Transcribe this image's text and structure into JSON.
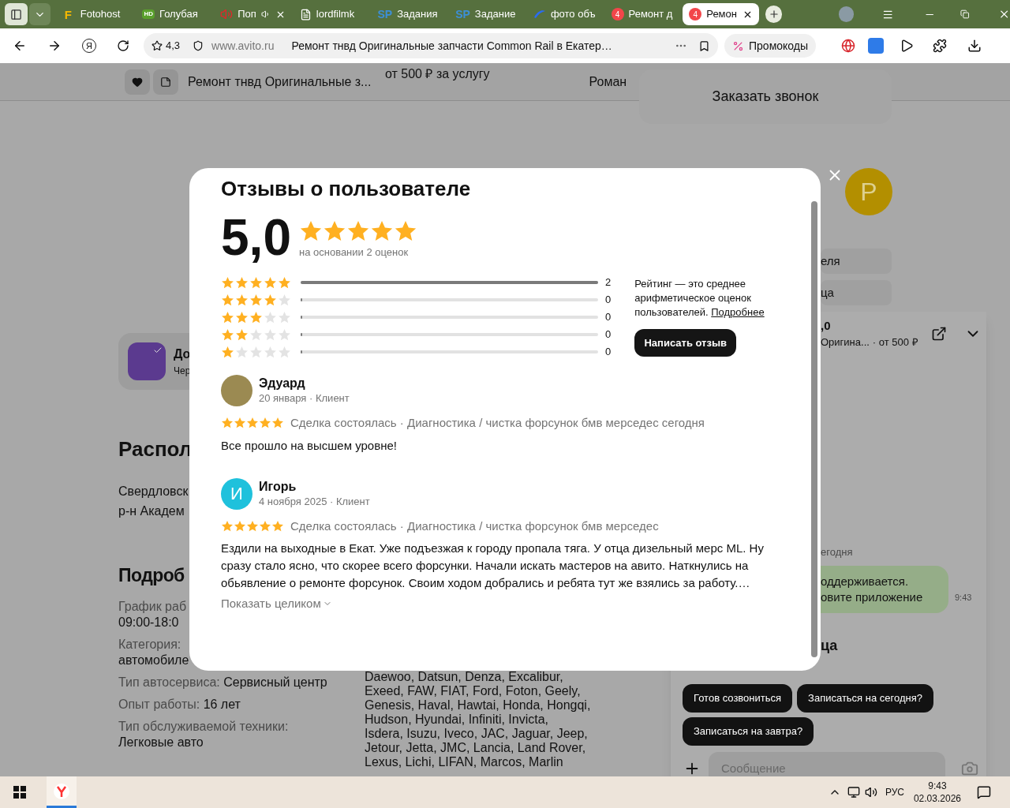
{
  "browser": {
    "tabs": [
      {
        "title": "Fotohost",
        "icon": {
          "kind": "letter",
          "text": "F"
        },
        "audio": false,
        "closable": false,
        "selected": false
      },
      {
        "title": "Голубая",
        "icon": {
          "kind": "hd",
          "text": "HD"
        },
        "audio": false,
        "closable": false,
        "selected": false
      },
      {
        "title": "Поп",
        "icon": {
          "kind": "sound"
        },
        "audio": true,
        "closable": true,
        "selected": false
      },
      {
        "title": "lordfilmk",
        "icon": {
          "kind": "page"
        },
        "audio": false,
        "closable": false,
        "selected": false
      },
      {
        "title": "Задания",
        "icon": {
          "kind": "sp",
          "text": "SP"
        },
        "audio": false,
        "closable": false,
        "selected": false
      },
      {
        "title": "Задание",
        "icon": {
          "kind": "sp",
          "text": "SP"
        },
        "audio": false,
        "closable": false,
        "selected": false
      },
      {
        "title": "фото объ",
        "icon": {
          "kind": "swoosh"
        },
        "audio": false,
        "closable": false,
        "selected": false
      },
      {
        "title": "Ремонт д",
        "icon": {
          "kind": "count",
          "text": "4"
        },
        "audio": false,
        "closable": false,
        "selected": false
      },
      {
        "title": "Ремон",
        "icon": {
          "kind": "count",
          "text": "4"
        },
        "audio": false,
        "closable": true,
        "selected": true
      }
    ],
    "address_bar": {
      "yandex_button": "Я",
      "rating": "4,3",
      "domain": "www.avito.ru",
      "page_title": "Ремонт тнвд Оригинальные запчасти Common Rail в Екатер…",
      "promo": "Промокоды"
    }
  },
  "page": {
    "header": {
      "title": "Ремонт тнвд Оригинальные з...",
      "price": "от 500 ₽ за услугу",
      "seller": "Роман",
      "call_button": "Заказать звонок"
    },
    "promo_card": {
      "title": "До",
      "subtitle": "Чер"
    },
    "location": {
      "heading": "Распол",
      "lines": [
        "Свердловск",
        "р-н Академ"
      ]
    },
    "details": {
      "heading": "Подроб",
      "items": [
        {
          "kind": "stacked",
          "label": "График раб",
          "value": "09:00-18:0"
        },
        {
          "kind": "stacked",
          "label": "Категория:",
          "value": "автомобиле"
        },
        {
          "kind": "inline",
          "label": "Тип автосервиса:",
          "value": "Сервисный центр"
        },
        {
          "kind": "inline",
          "label": "Опыт работы:",
          "value": "16 лет"
        },
        {
          "kind": "stacked",
          "label": "Тип обслуживаемой техники:",
          "value": "Легковые авто"
        }
      ],
      "brands": [
        "Daewoo, Datsun, Denza, Excalibur,",
        "Exeed, FAW, FIAT, Ford, Foton, Geely,",
        "Genesis, Haval, Hawtai, Honda, Hongqi,",
        "Hudson, Hyundai, Infiniti, Invicta,",
        "Isdera, Isuzu, Iveco, JAC, Jaguar, Jeep,",
        "Jetour, Jetta, JMC, Lancia, Land Rover,",
        "Lexus, Lichi, LIFAN, Marcos, Marlin"
      ]
    },
    "seller_panel": {
      "avatar_letter": "Р",
      "buttons": [
        "еля",
        "ца"
      ],
      "chat": {
        "rating": ",0",
        "title": "Оригина...",
        "price": "· от 500 ₽",
        "date": "егодня",
        "message": [
          "оддерживается.",
          "овите приложение"
        ],
        "time": "9:43",
        "heading": "ца",
        "quick_replies": [
          "Готов созвониться",
          "Записаться на сегодня?",
          "Записаться на завтра?"
        ],
        "input_placeholder": "Сообщение"
      }
    }
  },
  "reviews_modal": {
    "title": "Отзывы о пользователе",
    "score": "5,0",
    "stars": 5,
    "basis": "на основании 2 оценок",
    "histogram": [
      {
        "stars": 5,
        "level": 1,
        "count": "2"
      },
      {
        "stars": 4,
        "level": 0,
        "count": "0"
      },
      {
        "stars": 3,
        "level": 0,
        "count": "0"
      },
      {
        "stars": 2,
        "level": 0,
        "count": "0"
      },
      {
        "stars": 1,
        "level": 0,
        "count": "0"
      }
    ],
    "info": "Рейтинг — это среднее арифметическое оценок пользователей.",
    "info_link": "Подробнее",
    "write_button": "Написать отзыв",
    "reviews": [
      {
        "name": "Эдуард",
        "meta": "20 января · Клиент",
        "avatar": {
          "kind": "photo"
        },
        "stars": 5,
        "deal": "Сделка состоялась · Диагностика / чистка форсунок бмв мерседес сегодня",
        "text": "Все прошло на высшем уровне!"
      },
      {
        "name": "Игорь",
        "meta": "4 ноября 2025 · Клиент",
        "avatar": {
          "kind": "letter",
          "text": "И"
        },
        "stars": 5,
        "deal": "Сделка состоялась · Диагностика / чистка форсунок бмв мерседес",
        "text": "Ездили на выходные в Екат. Уже подъезжая к городу пропала тяга. У отца дизельный мерс ML. Ну сразу стало ясно, что скорее всего форсунки. Начали искать мастеров на авито. Наткнулись на обьявление о ремонте форсунок. Своим ходом добрались и ребята тут же взялись за работу.…",
        "more": "Показать целиком"
      }
    ]
  },
  "taskbar": {
    "apps": [
      {
        "kind": "browser",
        "selected": true
      }
    ],
    "language": "РУС",
    "time": "9:43",
    "date": "02.03.2026"
  }
}
